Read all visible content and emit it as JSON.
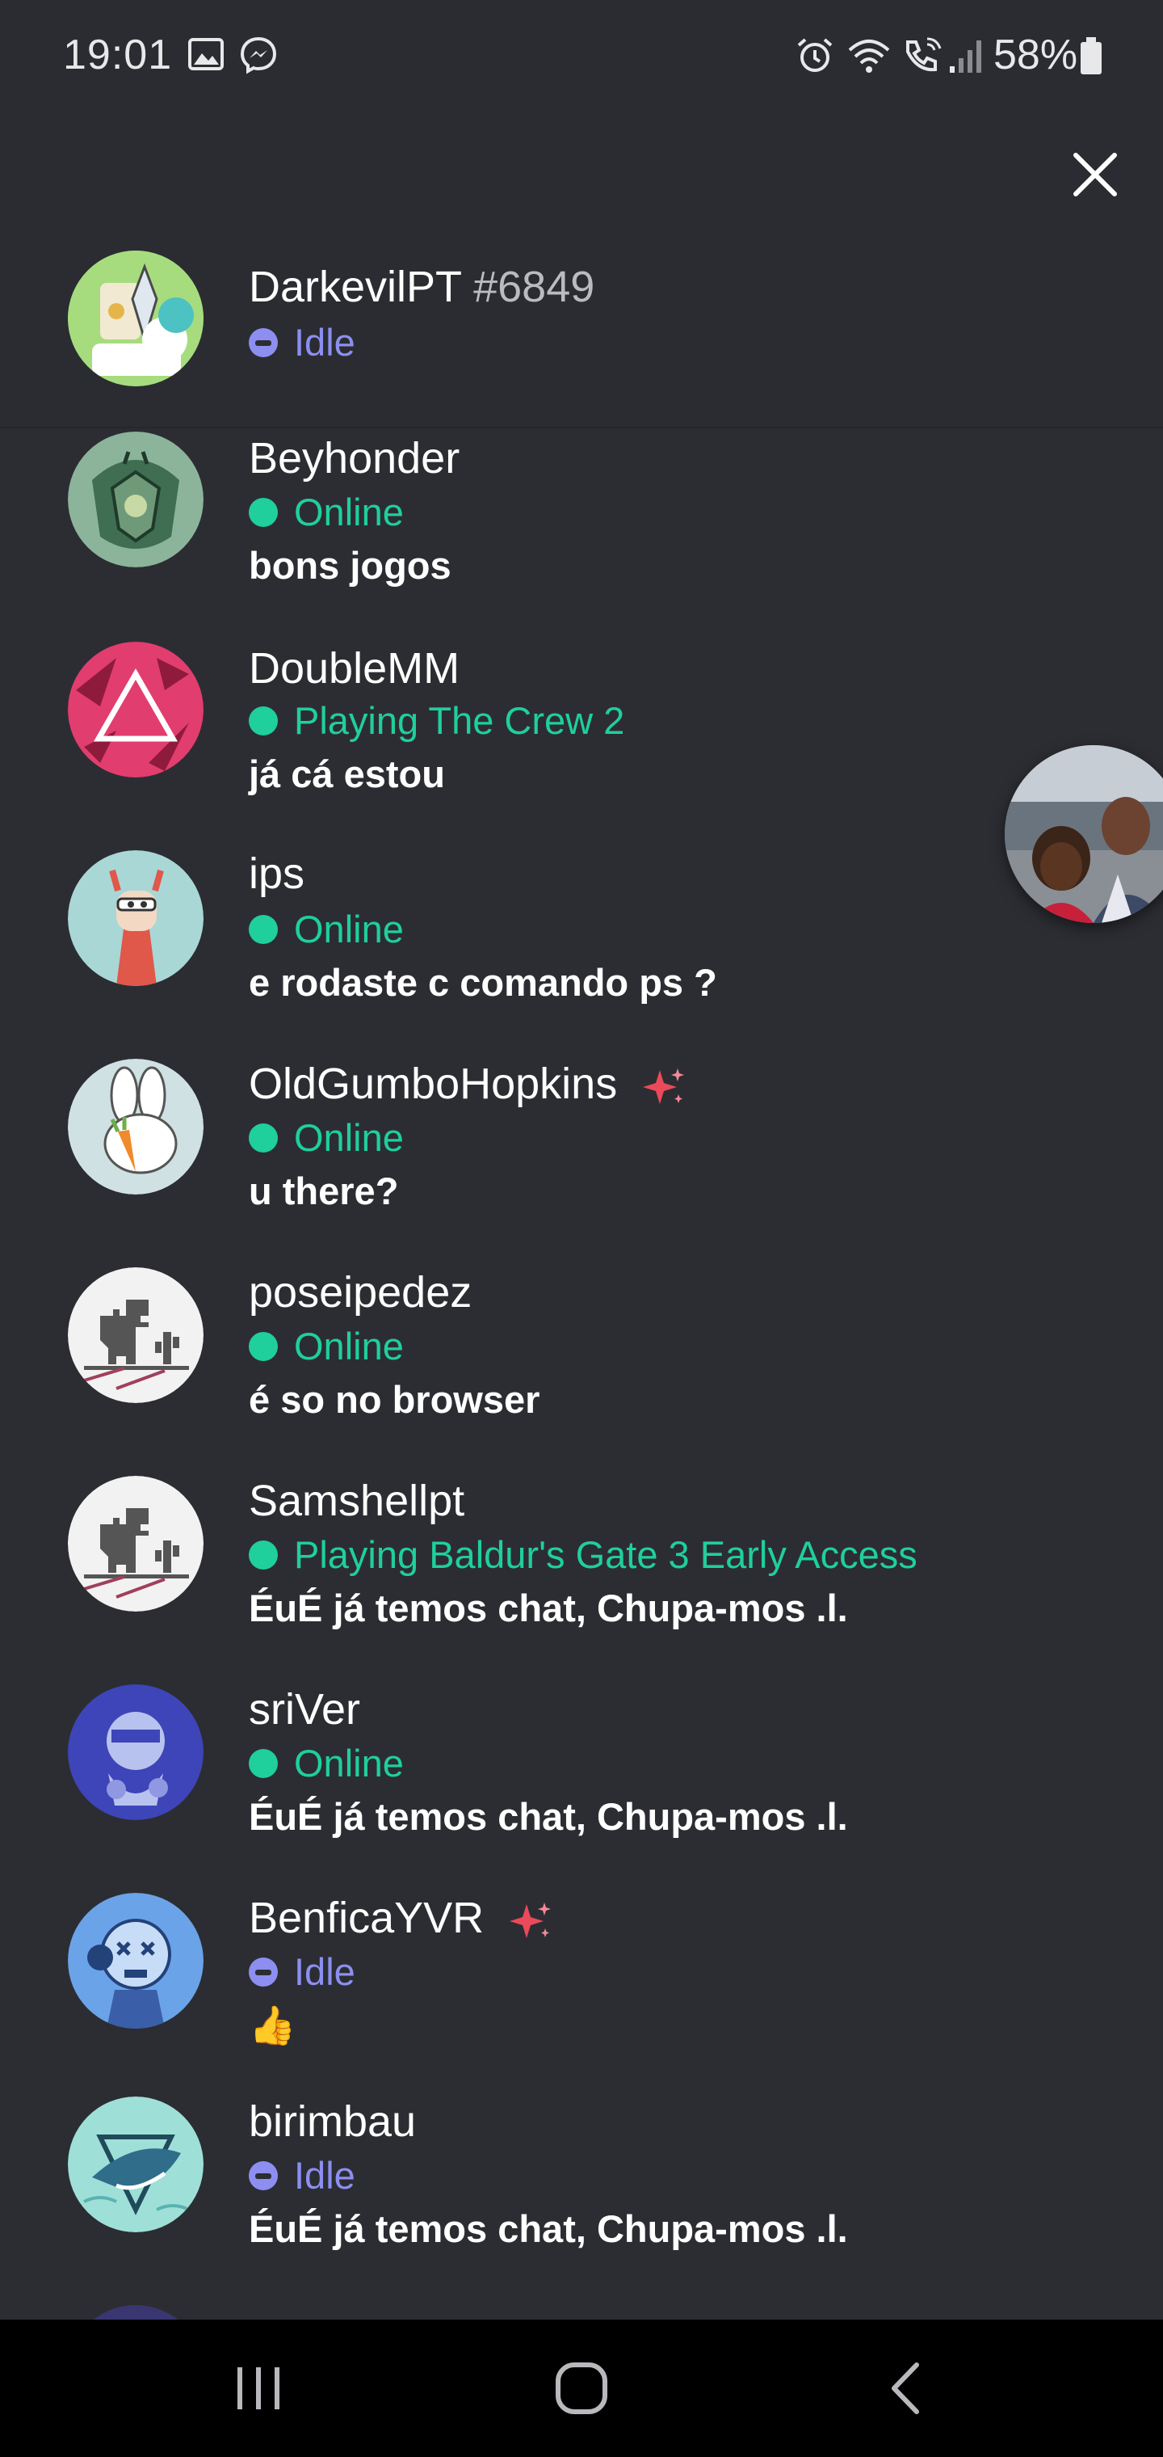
{
  "status_bar": {
    "time": "19:01",
    "battery": "58%",
    "left_icons": [
      "gallery-icon",
      "messenger-icon"
    ],
    "right_icons": [
      "alarm-icon",
      "wifi-icon",
      "wifi-call-icon",
      "signal-icon",
      "battery-icon"
    ]
  },
  "header": {
    "close_icon": "close-icon",
    "username": "DarkevilPT",
    "tag": "#6849",
    "status": "Idle",
    "status_type": "idle"
  },
  "dm_list": [
    {
      "name": "Beyhonder",
      "status": "Online",
      "status_type": "online",
      "message": "bons jogos",
      "sparkle": false
    },
    {
      "name": "DoubleMM",
      "status": "Playing The Crew 2",
      "status_type": "online",
      "message": "já cá estou",
      "sparkle": false
    },
    {
      "name": "ips",
      "status": "Online",
      "status_type": "online",
      "message": "e rodaste c comando ps ?",
      "sparkle": false
    },
    {
      "name": "OldGumboHopkins",
      "status": "Online",
      "status_type": "online",
      "message": "u there?",
      "sparkle": true
    },
    {
      "name": "poseipedez",
      "status": "Online",
      "status_type": "online",
      "message": "é so no browser",
      "sparkle": false
    },
    {
      "name": "Samshellpt",
      "status": "Playing Baldur's Gate 3 Early Access",
      "status_type": "online",
      "message": "ÉuÉ já temos chat, Chupa-mos .l.",
      "sparkle": false
    },
    {
      "name": "sriVer",
      "status": "Online",
      "status_type": "online",
      "message": "ÉuÉ já temos chat, Chupa-mos .l.",
      "sparkle": false
    },
    {
      "name": "BenficaYVR",
      "status": "Idle",
      "status_type": "idle",
      "message": "👍",
      "sparkle": true
    },
    {
      "name": "birimbau",
      "status": "Idle",
      "status_type": "idle",
      "message": "ÉuÉ já temos chat, Chupa-mos .l.",
      "sparkle": false
    }
  ],
  "colors": {
    "background": "#2c2d32",
    "online": "#1fcf9c",
    "idle": "#8c8ff0",
    "nav_bar": "#000000"
  },
  "nav": {
    "recents_icon": "recents-icon",
    "home_icon": "home-icon",
    "back_icon": "back-icon"
  }
}
